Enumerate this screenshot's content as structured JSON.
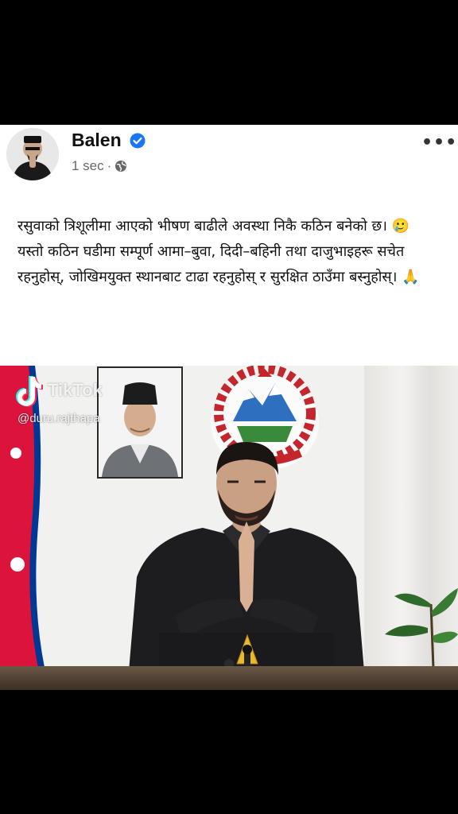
{
  "post": {
    "author": "Balen",
    "timestamp": "1 sec",
    "separator": "·",
    "more_label": "•••",
    "paragraph1": "रसुवाको त्रिशूलीमा आएको भीषण बाढीले अवस्था निकै कठिन बनेको छ। 🥲",
    "paragraph2": "यस्तो कठिन घडीमा सम्पूर्ण आमा–बुवा, दिदी–बहिनी तथा दाजुभाइहरू सचेत रहनुहोस्, जोखिमयुक्त स्थानबाट टाढा रहनुहोस् र सुरक्षित ठाउँमा बस्नुहोस्। 🙏",
    "icons": {
      "verified": "verified-badge-icon",
      "audience": "globe-icon",
      "more": "more-options-icon"
    },
    "colors": {
      "verified": "#1877f2",
      "meta": "#65676b",
      "flag_red": "#dc143c",
      "flag_blue": "#003893"
    }
  },
  "watermark": {
    "brand": "TikTok",
    "username": "@duru.rajthapa"
  }
}
